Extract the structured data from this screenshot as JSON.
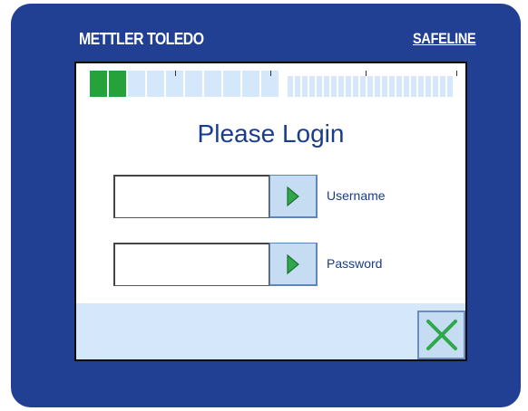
{
  "header": {
    "brand_left": "METTLER TOLEDO",
    "brand_right": "SAFELINE"
  },
  "progress": {
    "filled_segments": 2,
    "total_segments": 10
  },
  "login": {
    "title": "Please Login",
    "username_label": "Username",
    "password_label": "Password",
    "username_value": "",
    "password_value": ""
  },
  "icons": {
    "submit": "play-arrow-icon",
    "close": "close-x-icon"
  },
  "colors": {
    "panel": "#213f93",
    "accent_green": "#25a23a",
    "light_blue": "#d4e7fb",
    "text_blue": "#1a3c8c"
  }
}
